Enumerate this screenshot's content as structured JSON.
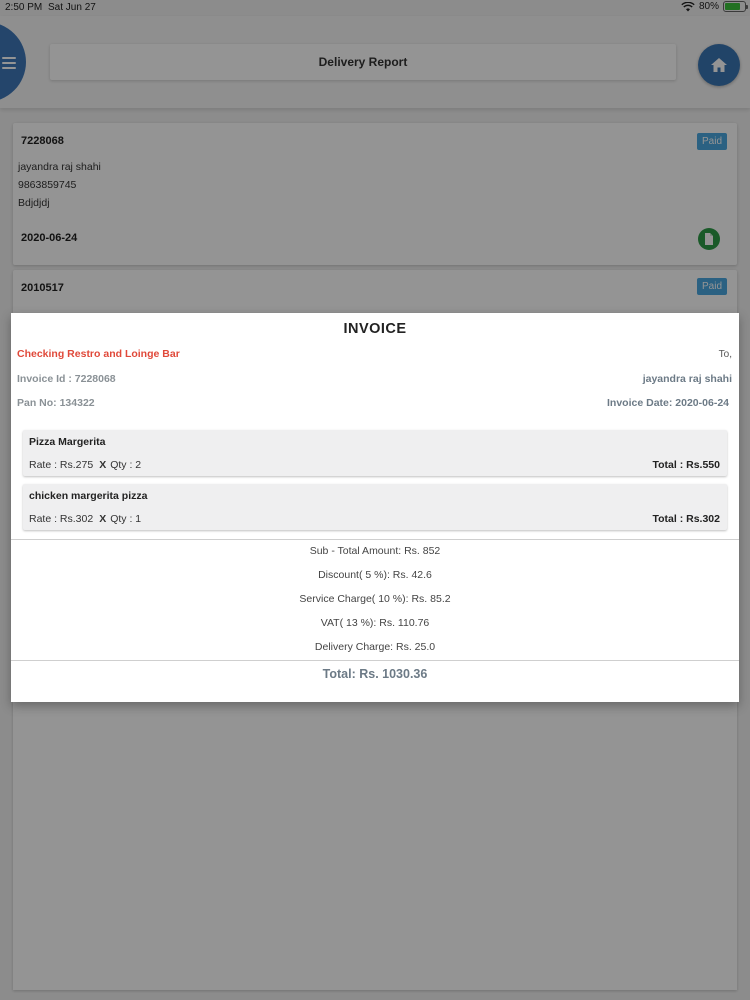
{
  "status_bar": {
    "time": "2:50 PM",
    "date": "Sat Jun 27",
    "battery": "80%"
  },
  "header": {
    "title": "Delivery Report",
    "menu_icon": "hamburger-icon",
    "home_icon": "home-icon"
  },
  "orders": [
    {
      "id": "7228068",
      "status": "Paid",
      "customer": "jayandra raj shahi",
      "phone": "9863859745",
      "address": "Bdjdjdj",
      "date": "2020-06-24"
    },
    {
      "id": "2010517",
      "status": "Paid"
    }
  ],
  "invoice": {
    "title": "INVOICE",
    "company": "Checking Restro and Loinge Bar",
    "to_label": "To,",
    "invoice_id": "Invoice Id : 7228068",
    "customer": "jayandra raj shahi",
    "pan": "Pan No: 134322",
    "invoice_date": "Invoice Date: 2020-06-24",
    "items": [
      {
        "name": "Pizza Margerita",
        "rate": "Rate : Rs.275",
        "x": "X",
        "qty": "Qty : 2",
        "total": "Total : Rs.550"
      },
      {
        "name": "chicken margerita pizza",
        "rate": "Rate : Rs.302",
        "x": "X",
        "qty": "Qty : 1",
        "total": "Total : Rs.302"
      }
    ],
    "subtotal": "Sub - Total Amount: Rs. 852",
    "discount": "Discount( 5 %): Rs. 42.6",
    "service_charge": "Service Charge( 10 %): Rs. 85.2",
    "vat": "VAT( 13 %): Rs. 110.76",
    "delivery_charge": "Delivery Charge: Rs. 25.0",
    "grand_total": "Total: Rs. 1030.36"
  },
  "colors": {
    "accent": "#3a76b4",
    "paid_badge": "#4aa8e0",
    "company": "#e0493a",
    "doc_icon": "#2e9b47"
  }
}
